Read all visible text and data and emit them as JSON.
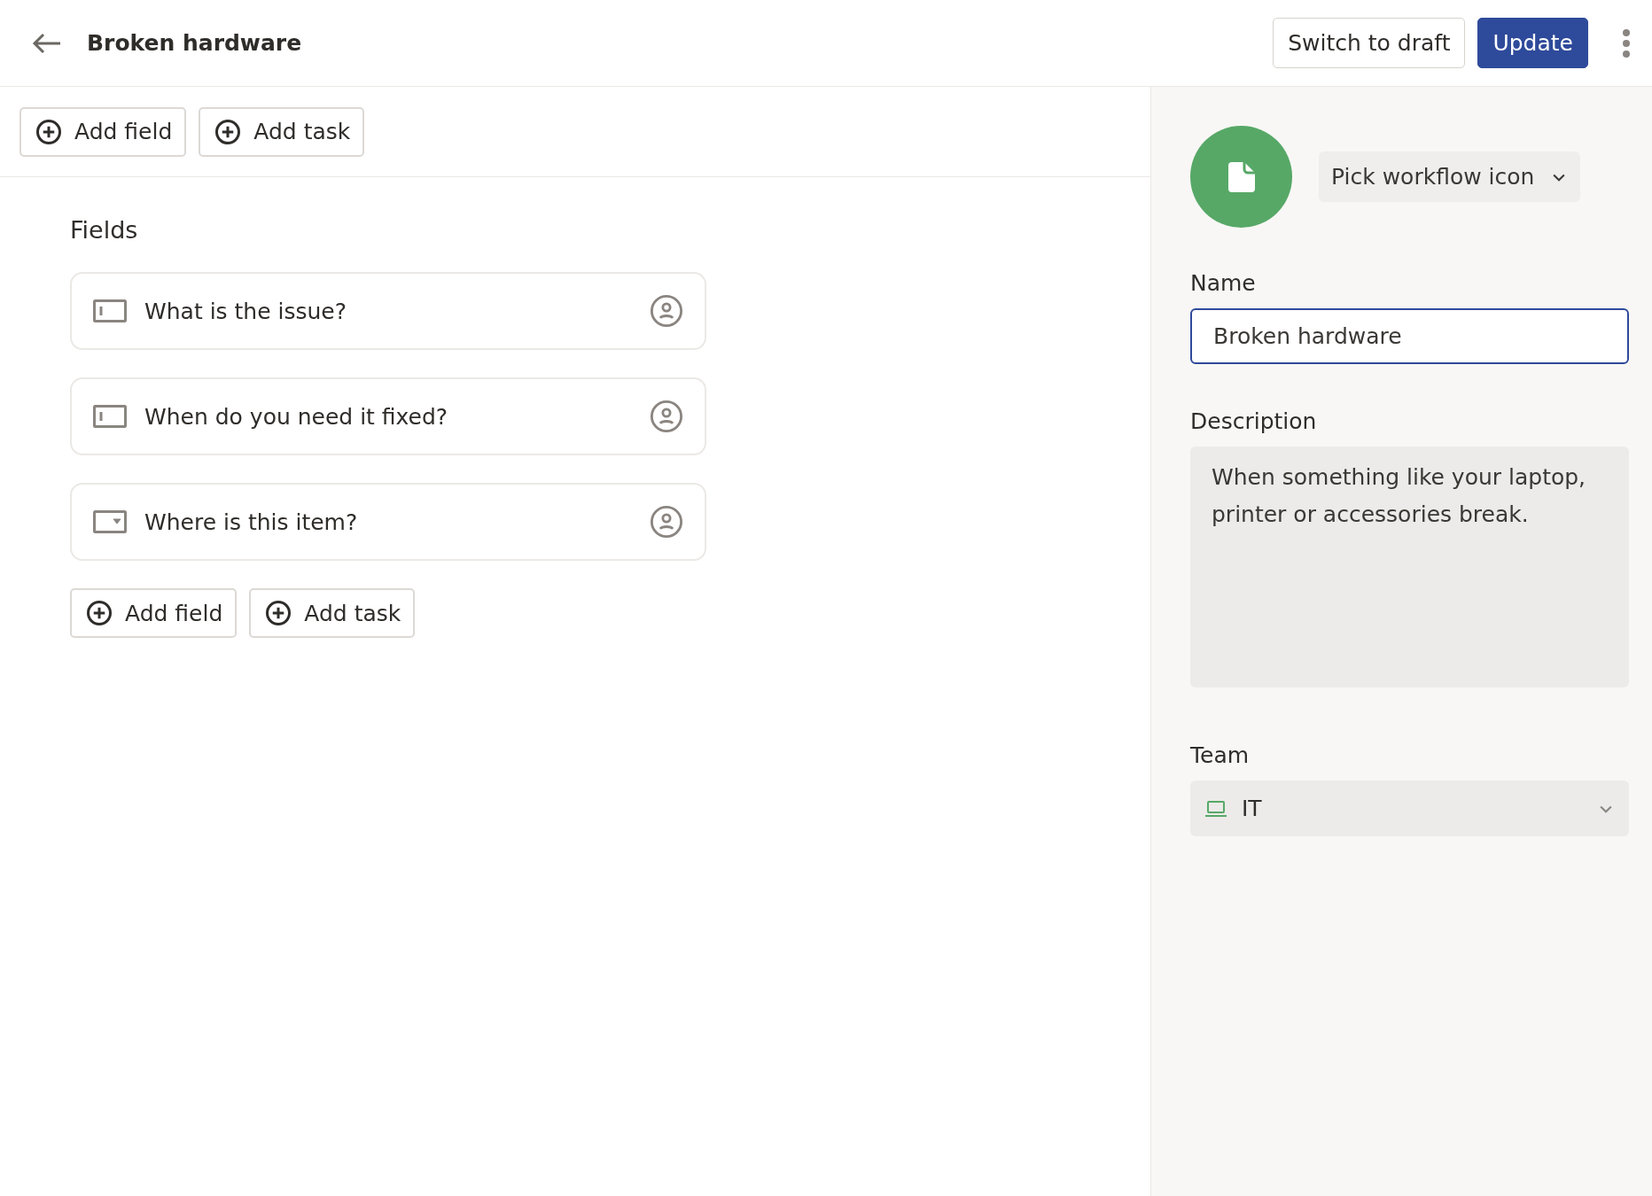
{
  "header": {
    "title": "Broken hardware",
    "buttons": [
      {
        "label": "Switch to draft",
        "kind": "secondary"
      },
      {
        "label": "Update",
        "kind": "primary"
      }
    ]
  },
  "toolbar": {
    "buttons": [
      "Add field",
      "Add task"
    ]
  },
  "fields_section": {
    "heading": "Fields",
    "fields": [
      {
        "label": "What is the issue?",
        "kind": "text"
      },
      {
        "label": "When do you need it fixed?",
        "kind": "text"
      },
      {
        "label": "Where is this item?",
        "kind": "select"
      }
    ],
    "buttons": [
      "Add field",
      "Add task"
    ]
  },
  "settings": {
    "icon_picker": "Pick workflow icon",
    "name_label": "Name",
    "name_value": "Broken hardware",
    "description_label": "Description",
    "description_value": "When something like your laptop, printer or accessories break.",
    "team_label": "Team",
    "team_value": "IT"
  }
}
